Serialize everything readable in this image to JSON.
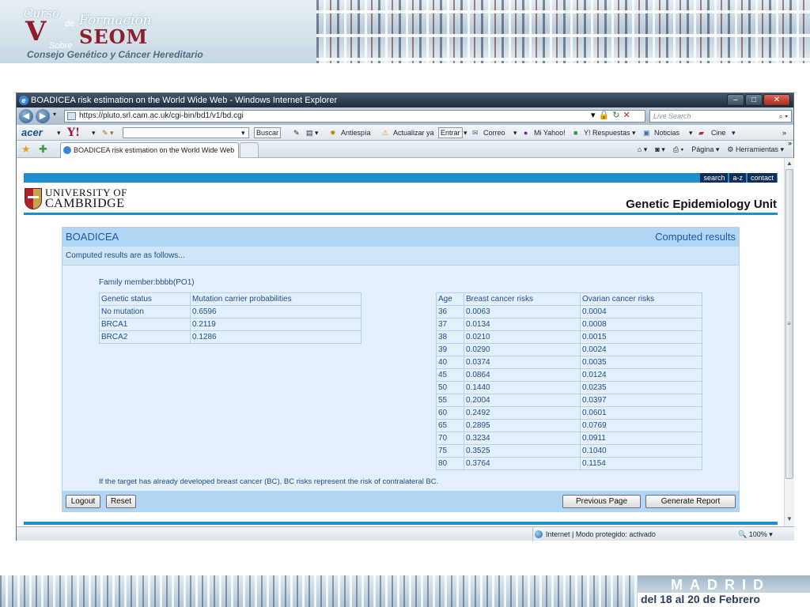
{
  "slide": {
    "logo": {
      "curso": "Curso",
      "de": "de",
      "formacion": "Formación",
      "numeral": "V",
      "seom": "SEOM",
      "sobre": "Sobre",
      "tagline": "Consejo Genético y Cáncer Hereditario"
    },
    "footer": {
      "city": "MADRID",
      "dates": "del 18 al 20 de Febrero"
    }
  },
  "browser": {
    "window_title": "BOADICEA risk estimation on the World Wide Web - Windows Internet Explorer",
    "url": "https://pluto.srl.cam.ac.uk/cgi-bin/bd1/v1/bd.cgi",
    "search_placeholder": "Live Search",
    "toolbar": {
      "brand": "acer",
      "yahoo": "Y!",
      "buscar": "Buscar",
      "antiespia": "Antiespía",
      "actualizar": "Actualizar ya",
      "entrar": "Entrar",
      "correo": "Correo",
      "mi_yahoo": "Mi Yahoo!",
      "respuestas": "Y! Respuestas",
      "noticias": "Noticias",
      "cine": "Cine"
    },
    "tab_label": "BOADICEA risk estimation on the World Wide Web",
    "commands": {
      "pagina": "Página",
      "herramientas": "Herramientas"
    },
    "status": {
      "zone": "Internet | Modo protegido: activado",
      "zoom": "100%"
    }
  },
  "page": {
    "nav": [
      "search",
      "a-z",
      "contact"
    ],
    "university_line1": "UNIVERSITY OF",
    "university_line2": "CAMBRIDGE",
    "unit": "Genetic Epidemiology Unit",
    "panel_title": "BOADICEA",
    "panel_right": "Computed results",
    "intro": "Computed results are as follows...",
    "family_member": "Family member:bbbb(PO1)",
    "genetic_table": {
      "headers": [
        "Genetic status",
        "Mutation carrier probabilities"
      ],
      "rows": [
        [
          "No mutation",
          "0.6596"
        ],
        [
          "BRCA1",
          "0.2119"
        ],
        [
          "BRCA2",
          "0.1286"
        ]
      ]
    },
    "risk_table": {
      "headers": [
        "Age",
        "Breast cancer risks",
        "Ovarian cancer risks"
      ],
      "rows": [
        [
          "36",
          "0.0063",
          "0.0004"
        ],
        [
          "37",
          "0.0134",
          "0.0008"
        ],
        [
          "38",
          "0.0210",
          "0.0015"
        ],
        [
          "39",
          "0.0290",
          "0.0024"
        ],
        [
          "40",
          "0.0374",
          "0.0035"
        ],
        [
          "45",
          "0.0864",
          "0.0124"
        ],
        [
          "50",
          "0.1440",
          "0.0235"
        ],
        [
          "55",
          "0.2004",
          "0.0397"
        ],
        [
          "60",
          "0.2492",
          "0.0601"
        ],
        [
          "65",
          "0.2895",
          "0.0769"
        ],
        [
          "70",
          "0.3234",
          "0.0911"
        ],
        [
          "75",
          "0.3525",
          "0.1040"
        ],
        [
          "80",
          "0.3764",
          "0.1154"
        ]
      ]
    },
    "note": "If the target has already developed breast cancer (BC), BC risks represent the risk of contralateral BC.",
    "buttons": {
      "logout": "Logout",
      "reset": "Reset",
      "previous": "Previous Page",
      "generate": "Generate Report"
    }
  }
}
